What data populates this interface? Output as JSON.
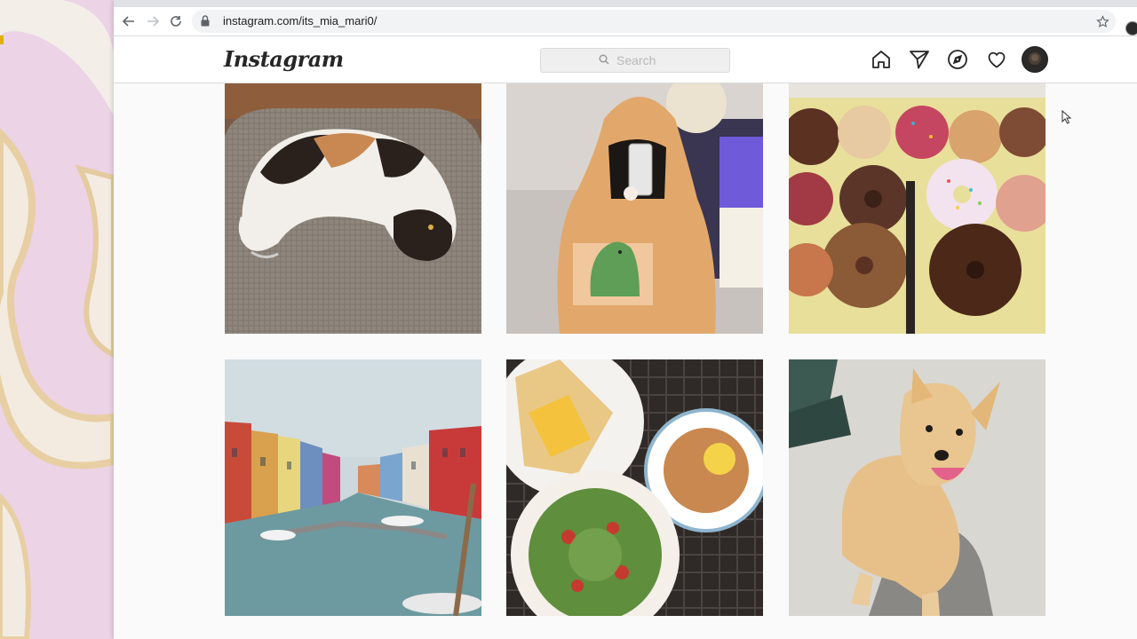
{
  "browser": {
    "url": "instagram.com/its_mia_mari0/",
    "nav": {
      "back": "back-icon",
      "forward": "forward-icon",
      "reload": "reload-icon"
    },
    "icons": {
      "lock": "lock-icon",
      "bookmark": "star-icon"
    }
  },
  "instagram": {
    "logo": "Instagram",
    "search": {
      "placeholder": "Search",
      "icon": "search-icon"
    },
    "nav_icons": [
      "home-icon",
      "direct-icon",
      "explore-icon",
      "activity-icon",
      "profile-avatar"
    ]
  },
  "posts": [
    {
      "subject": "calico-cat-on-cushion"
    },
    {
      "subject": "hoodie-mirror-selfie"
    },
    {
      "subject": "box-of-donuts"
    },
    {
      "subject": "colorful-canal-houses"
    },
    {
      "subject": "brunch-plates"
    },
    {
      "subject": "small-tan-dog"
    }
  ],
  "colors": {
    "ig_text": "#262626",
    "border": "#dbdbdb",
    "wallpaper": "#ecd3e6"
  }
}
